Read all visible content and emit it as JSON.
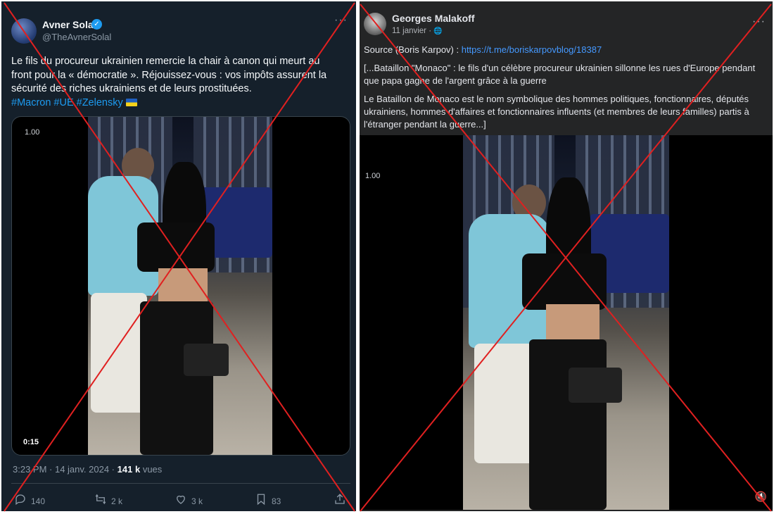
{
  "left_post": {
    "author_name": "Avner Solal",
    "handle": "@TheAvnerSolal",
    "more_label": "···",
    "verified_glyph": "✓",
    "text": "Le fils du procureur ukrainien remercie la chair à canon qui meurt au front pour la « démocratie ». Réjouissez-vous : vos impôts assurent la sécurité des riches ukrainiens et de leurs prostituées.",
    "hashtags": [
      "#Macron",
      "#UE",
      "#Zelensky"
    ],
    "video": {
      "speed_label": "1.00",
      "duration": "0:15"
    },
    "timestamp": "3:23 PM · 14 janv. 2024 ·",
    "views_count": "141 k",
    "views_label": "vues",
    "actions": {
      "replies": "140",
      "reposts": "2 k",
      "likes": "3 k",
      "bookmarks": "83"
    },
    "icons": {
      "reply": "reply-icon",
      "repost": "repost-icon",
      "like": "heart-icon",
      "bookmark": "bookmark-icon",
      "share": "share-icon"
    }
  },
  "right_post": {
    "author_name": "Georges Malakoff",
    "date": "11 janvier ·",
    "globe_glyph": "🌐",
    "more_label": "···",
    "source_prefix": "Source (Boris Karpov) : ",
    "source_link": "https://t.me/boriskarpovblog/18387",
    "paragraph1": "[...Bataillon \"Monaco\" : le fils d'un célèbre procureur ukrainien sillonne les rues d'Europe pendant que papa gagne de l'argent grâce à la guerre",
    "paragraph2": "Le Bataillon de Monaco est le nom symbolique des hommes politiques, fonctionnaires, députés ukrainiens, hommes d'affaires et fonctionnaires influents (et membres de leurs familles) partis à l'étranger pendant la guerre...]",
    "video": {
      "speed_label": "1.00"
    },
    "mute_glyph": "🔇"
  },
  "colors": {
    "left_bg": "#15202b",
    "right_bg": "#242526",
    "accent_x": "#1d9bf0",
    "accent_fb": "#4599ff",
    "cross": "#e02020"
  }
}
